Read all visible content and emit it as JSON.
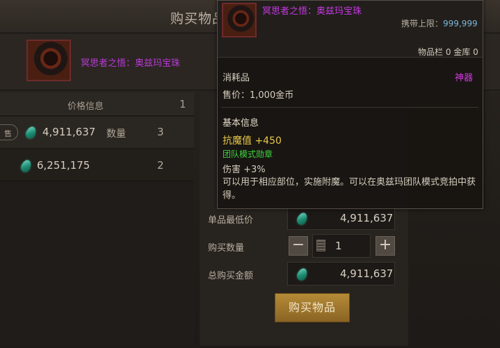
{
  "window": {
    "title": "购买物品",
    "item_name": "冥思者之悟：奥兹玛宝珠"
  },
  "price_table": {
    "header_label": "价格信息",
    "page_number": "1",
    "rows": [
      {
        "sell_tag": "售",
        "price": "4,911,637",
        "qty_label": "数量",
        "qty": "3"
      },
      {
        "price": "6,251,175",
        "qty": "2"
      }
    ]
  },
  "purchase": {
    "unit_price_label": "单品最低价",
    "unit_price": "4,911,637",
    "quantity_label": "购买数量",
    "quantity": "1",
    "minus": "−",
    "plus": "+",
    "total_label": "总购买金额",
    "total": "4,911,637",
    "buy_label": "购买物品"
  },
  "tooltip": {
    "name": "冥思者之悟：奥兹玛宝珠",
    "carry_limit_label": "携带上限：",
    "carry_limit": "999,999",
    "stock": "物品栏 0 金库 0",
    "type": "消耗品",
    "rarity": "神器",
    "sell_price": "售价：1,000金币",
    "section_title": "基本信息",
    "stat_magic_resist": "抗魔值 +450",
    "stat_badge": "团队模式勋章",
    "stat_damage": "伤害 +3%",
    "description": "可以用于相应部位，实施附魔。可以在奥兹玛团队模式竞拍中获得。"
  },
  "colors": {
    "rare_item": "#c63ae3",
    "gold_stat": "#e8c84a",
    "green_stat": "#3ed43e",
    "buy_button": "#a87d30"
  }
}
